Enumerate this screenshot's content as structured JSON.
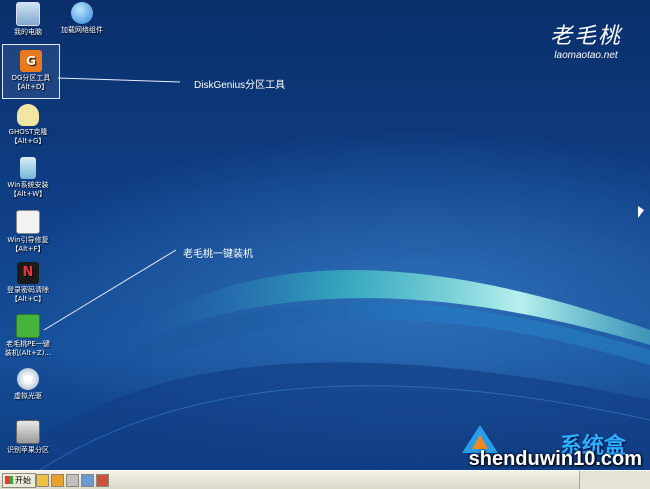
{
  "desktop": {
    "icons": [
      {
        "label": "我的电脑",
        "icon": "computer-icon"
      },
      {
        "label": "加载网络组件",
        "icon": "network-globe-icon"
      },
      {
        "label": "DG分区工具\n【Alt+D】",
        "icon": "diskgenius-icon"
      },
      {
        "label": "GHOST克隆\n【Alt+G】",
        "icon": "ghost-icon"
      },
      {
        "label": "Win系统安装\n【Alt+W】",
        "icon": "windows-setup-icon"
      },
      {
        "label": "Win引导修复\n【Alt+F】",
        "icon": "boot-repair-icon"
      },
      {
        "label": "登录密码清除\n【Alt+C】",
        "icon": "password-clear-icon"
      },
      {
        "label": "老毛桃PE一键\n装机(Alt+Z)...",
        "icon": "one-click-install-icon"
      },
      {
        "label": "虚拟光驱",
        "icon": "virtual-cdrom-icon"
      },
      {
        "label": "识别苹果分区",
        "icon": "apple-partition-icon"
      }
    ],
    "callouts": {
      "diskgenius": "DiskGenius分区工具",
      "oneclick": "老毛桃一键装机"
    },
    "brand": {
      "logo": "老毛桃",
      "site": "laomaotao.net"
    }
  },
  "watermark": {
    "top": "系统盒",
    "bottom": "shenduwin10.com"
  },
  "taskbar": {
    "start_label": "开始",
    "quick_launch": [
      "app-icon",
      "folder-icon",
      "disk-icon",
      "tool-icon",
      "media-icon"
    ]
  },
  "colors": {
    "desktop": "#0f3f86",
    "taskbar": "#ece9d8",
    "accent": "#2ab0ff"
  }
}
